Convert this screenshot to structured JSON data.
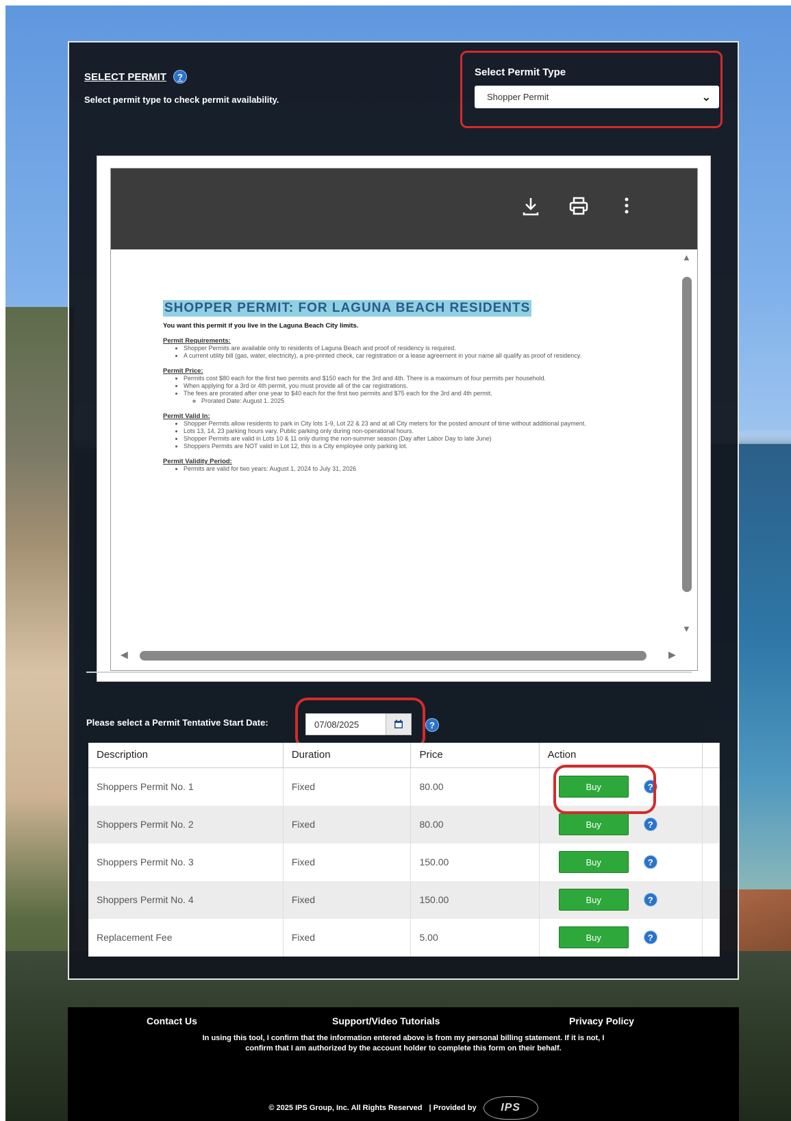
{
  "header": {
    "title": "SELECT PERMIT",
    "help": "?",
    "subtitle": "Select permit type to check permit availability."
  },
  "permit_type": {
    "label": "Select Permit Type",
    "selected": "Shopper Permit"
  },
  "pdf": {
    "title": "SHOPPER PERMIT: FOR LAGUNA BEACH RESIDENTS",
    "lead": "You want this permit if you live in the Laguna Beach City limits.",
    "sections": [
      {
        "heading": "Permit Requirements:",
        "items": [
          "Shopper Permits are available only to residents of Laguna Beach and proof of residency is required.",
          "A current utility bill (gas, water, electricity), a pre-printed check, car registration or a lease agreement in your name all qualify as proof of residency."
        ]
      },
      {
        "heading": "Permit Price:",
        "items": [
          "Permits cost $80 each for the first two permits and $150 each for the 3rd and 4th. There is a maximum of four permits per household.",
          "When applying for a 3rd or 4th permit, you must provide all of the car registrations.",
          "The fees are prorated after one year to $40 each for the first two permits and $75 each for the 3rd and 4th permit."
        ],
        "subitems": [
          "Prorated Date: August 1. 2025"
        ]
      },
      {
        "heading": "Permit Valid In:",
        "items": [
          "Shopper Permits allow residents to park in City lots 1-9, Lot 22 & 23 and at all City meters for the posted amount of time without additional payment.",
          "Lots 13, 14, 23 parking hours vary. Public parking only during non-operational hours.",
          "Shopper Permits are valid in Lots 10 & 11 only during the non-summer season (Day after Labor Day to late June)",
          "Shoppers Permits are NOT valid in Lot 12, this is a City employee only parking lot."
        ]
      },
      {
        "heading": "Permit Validity Period:",
        "items": [
          "Permits are valid for two years: August 1, 2024 to July 31, 2026"
        ]
      }
    ]
  },
  "date": {
    "label": "Please select a Permit Tentative Start Date:",
    "value": "07/08/2025"
  },
  "table": {
    "headers": [
      "Description",
      "Duration",
      "Price",
      "Action"
    ],
    "rows": [
      {
        "description": "Shoppers Permit No. 1",
        "duration": "Fixed",
        "price": "80.00",
        "action": "Buy"
      },
      {
        "description": "Shoppers Permit No. 2",
        "duration": "Fixed",
        "price": "80.00",
        "action": "Buy"
      },
      {
        "description": "Shoppers Permit No. 3",
        "duration": "Fixed",
        "price": "150.00",
        "action": "Buy"
      },
      {
        "description": "Shoppers Permit No. 4",
        "duration": "Fixed",
        "price": "150.00",
        "action": "Buy"
      },
      {
        "description": "Replacement Fee",
        "duration": "Fixed",
        "price": "5.00",
        "action": "Buy"
      }
    ]
  },
  "footer": {
    "links": [
      "Contact Us",
      "Support/Video Tutorials",
      "Privacy Policy"
    ],
    "note": "In using this tool, I confirm that the information entered above is from my personal billing statement. If it is not, I confirm that I am authorized by the account holder to complete this form on their behalf.",
    "copyright": "© 2025 IPS Group, Inc. All Rights Reserved",
    "provided_by": "| Provided by",
    "logo_text": "IPS"
  },
  "colors": {
    "accent_red": "#d32b2b",
    "buy_green": "#2ea83a",
    "help_blue": "#2a73c9",
    "panel_bg": "#12161e"
  }
}
